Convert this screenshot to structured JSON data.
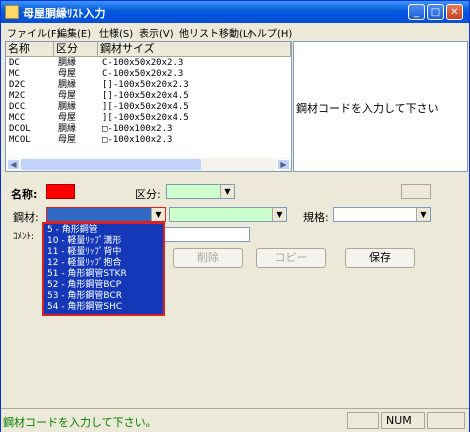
{
  "window": {
    "title": "母屋胴縁ﾘｽﾄ入力"
  },
  "menu": [
    "ファイル(F)",
    "編集(E)",
    "仕様(S)",
    "表示(V)",
    "他リスト移動(L)",
    "ヘルプ(H)"
  ],
  "list": {
    "headers": [
      "名称",
      "区分",
      "鋼材サイズ"
    ],
    "rows": [
      [
        "DC",
        "胴縁",
        "C-100x50x20x2.3"
      ],
      [
        "MC",
        "母屋",
        "C-100x50x20x2.3"
      ],
      [
        "D2C",
        "胴縁",
        "[]-100x50x20x2.3"
      ],
      [
        "M2C",
        "母屋",
        "[]-100x50x20x4.5"
      ],
      [
        "DCC",
        "胴縁",
        "][-100x50x20x4.5"
      ],
      [
        "MCC",
        "母屋",
        "][-100x50x20x4.5"
      ],
      [
        "DCOL",
        "胴縁",
        "□-100x100x2.3"
      ],
      [
        "MCOL",
        "母屋",
        "□-100x100x2.3"
      ]
    ]
  },
  "right_panel": {
    "message": "鋼材コードを入力して下さい"
  },
  "form": {
    "name_label": "名称:",
    "kubun_label": "区分:",
    "kozai_label": "鋼材:",
    "kikaku_label": "規格:",
    "comment_label": "ｺﾒﾝﾄ:",
    "name_color": "#ff0000",
    "kubun_color": "#ccffcc",
    "kozai_color": "#316ac5"
  },
  "buttons": {
    "delete": "削除",
    "copy": "コピー",
    "save": "保存"
  },
  "dropdown_items": [
    "5 - 角形鋼管",
    "10 - 軽量ﾘｯﾌﾟ溝形",
    "11 - 軽量ﾘｯﾌﾟ背中",
    "12 - 軽量ﾘｯﾌﾟ抱合",
    "51 - 角形鋼管STKR",
    "52 - 角形鋼管BCP",
    "53 - 角形鋼管BCR",
    "54 - 角形鋼管SHC"
  ],
  "status": {
    "text": "鋼材コードを入力して下さい。",
    "num": "NUM"
  }
}
